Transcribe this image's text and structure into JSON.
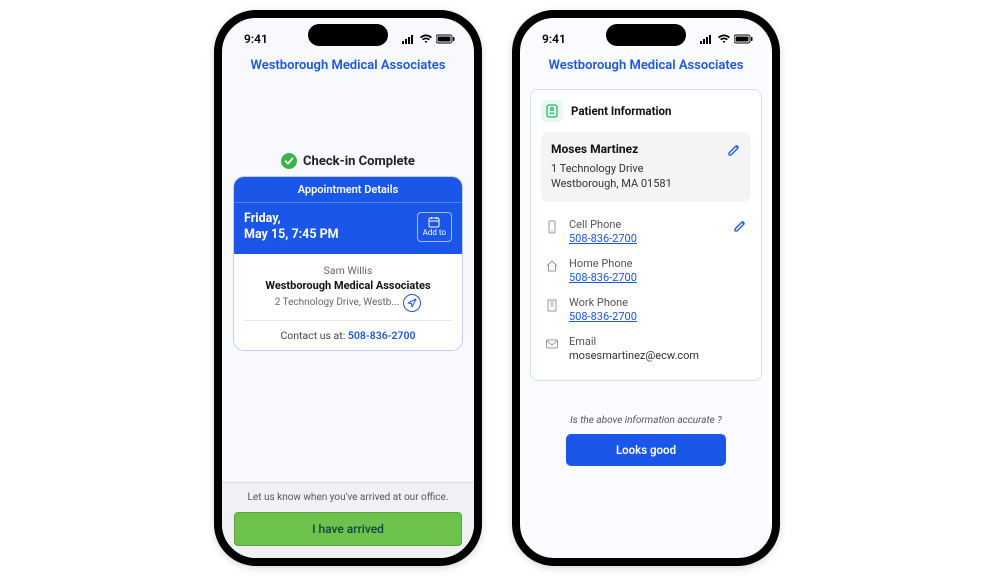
{
  "status_bar": {
    "time": "9:41"
  },
  "header": {
    "title": "Westborough Medical Associates"
  },
  "phone1": {
    "checkin_status": "Check-in Complete",
    "appt_details_header": "Appointment Details",
    "appt_day": "Friday,",
    "appt_datetime": "May 15, 7:45 PM",
    "add_to_label": "Add to",
    "provider": "Sam Willis",
    "facility": "Westborough Medical Associates",
    "address_truncated": "2 Technology Drive, Westb...",
    "contact_label": "Contact us at: ",
    "contact_phone": "508-836-2700",
    "footer_hint": "Let us know when you've arrived at our office.",
    "arrived_button": "I have arrived"
  },
  "phone2": {
    "panel_title": "Patient Information",
    "patient": {
      "name": "Moses Martinez",
      "address_line1": "1 Technology Drive",
      "address_line2": "Westborough, MA 01581"
    },
    "fields": {
      "cell": {
        "label": "Cell Phone",
        "value": "508-836-2700"
      },
      "home": {
        "label": "Home Phone",
        "value": "508-836-2700"
      },
      "work": {
        "label": "Work Phone",
        "value": "508-836-2700"
      },
      "email": {
        "label": "Email",
        "value": "mosesmartinez@ecw.com"
      }
    },
    "confirm_question": "Is the above information accurate ?",
    "looks_good_button": "Looks good"
  }
}
